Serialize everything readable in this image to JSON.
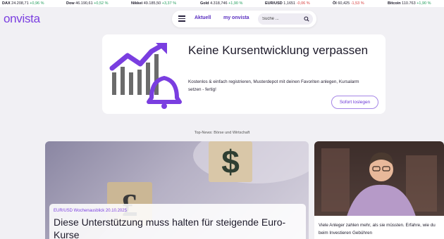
{
  "ticker": [
    {
      "name": "DAX",
      "value": "24.208,71",
      "change": "+0,96 %",
      "dir": "up"
    },
    {
      "name": "Dow",
      "value": "46.190,61",
      "change": "+0,52 %",
      "dir": "up"
    },
    {
      "name": "Nikkei",
      "value": "49.185,50",
      "change": "+3,37 %",
      "dir": "up"
    },
    {
      "name": "Gold",
      "value": "4.318,746",
      "change": "+1,90 %",
      "dir": "up"
    },
    {
      "name": "EUR/USD",
      "value": "1,1651",
      "change": "-0,06 %",
      "dir": "down"
    },
    {
      "name": "Öl",
      "value": "60,425",
      "change": "-1,53 %",
      "dir": "down"
    },
    {
      "name": "Bitcoin",
      "value": "110.763",
      "change": "+1,90 %",
      "dir": "up"
    }
  ],
  "header": {
    "logo": "onvista",
    "menu_icon": "hamburger-menu-icon",
    "nav": [
      "Aktuell",
      "my onvista"
    ],
    "search_placeholder": "Suche ...",
    "search_icon": "search-icon"
  },
  "promo": {
    "title": "Keine Kursentwicklung verpassen",
    "text": "Kostenlos & einfach registrieren, Musterdepot mit deinen Favoriten anlegen, Kursalarm setzen - fertig!",
    "button": "Sofort loslegen",
    "icon": "chart-bell-icon",
    "accent": "#7a3ee0"
  },
  "section_label": "Top-News: Börse und Wirtschaft",
  "news": {
    "main": {
      "kicker": "EUR/USD Wochenausblick 20.10.2025",
      "title": "Diese Unterstützung muss halten für steigende Euro-Kurse",
      "image_icons": [
        "dollar-cube-icon",
        "pound-cube-icon"
      ]
    },
    "side": {
      "text": "Viele Anleger zahlen mehr, als sie müssten. Erfahre, wie du beim Investieren Gebühren"
    }
  },
  "colors": {
    "brand": "#7a3ee0",
    "up": "#1f9c5a",
    "down": "#d63a3a",
    "background": "#f1f0f4"
  }
}
